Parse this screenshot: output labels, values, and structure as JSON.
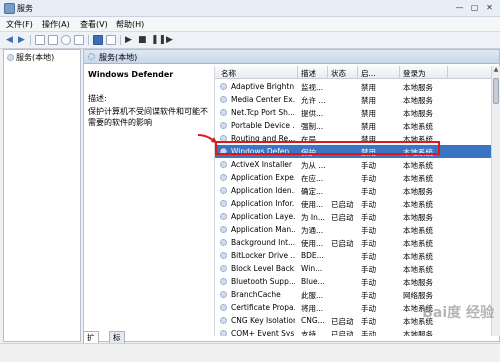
{
  "window": {
    "title": "服务",
    "minimize": "—",
    "maximize": "▢",
    "close": "✕"
  },
  "menu": [
    "文件(F)",
    "操作(A)",
    "查看(V)",
    "帮助(H)"
  ],
  "toolbar": {
    "icons": [
      "back-icon",
      "forward-icon",
      "console-tree-icon",
      "properties-icon",
      "refresh-icon",
      "export-icon",
      "help-icon",
      "view-icon",
      "start-icon",
      "stop-icon",
      "pause-icon",
      "restart-icon"
    ]
  },
  "tree": {
    "root": "服务(本地)"
  },
  "panel": {
    "header": "服务(本地)",
    "service_name": "Windows Defender",
    "desc_label": "描述:",
    "desc_text": "保护计算机不受间谍软件和可能不需要的软件的影响"
  },
  "columns": [
    "名称",
    "描述",
    "状态",
    "启...",
    "登录为"
  ],
  "rows": [
    {
      "name": "Adaptive Brightn...",
      "desc": "监视...",
      "status": "",
      "startup": "禁用",
      "logon": "本地服务"
    },
    {
      "name": "Media Center Ex...",
      "desc": "允许 ...",
      "status": "",
      "startup": "禁用",
      "logon": "本地服务"
    },
    {
      "name": "Net.Tcp Port Sh...",
      "desc": "提供...",
      "status": "",
      "startup": "禁用",
      "logon": "本地服务"
    },
    {
      "name": "Portable Device ...",
      "desc": "强制...",
      "status": "",
      "startup": "禁用",
      "logon": "本地系统"
    },
    {
      "name": "Routing and Re...",
      "desc": "在局...",
      "status": "",
      "startup": "禁用",
      "logon": "本地系统"
    },
    {
      "name": "Windows Defen...",
      "desc": "保护...",
      "status": "",
      "startup": "禁用",
      "logon": "本地系统",
      "selected": true
    },
    {
      "name": "ActiveX Installer ...",
      "desc": "为从 ...",
      "status": "",
      "startup": "手动",
      "logon": "本地系统"
    },
    {
      "name": "Application Expe...",
      "desc": "在应...",
      "status": "",
      "startup": "手动",
      "logon": "本地系统"
    },
    {
      "name": "Application Iden...",
      "desc": "确定...",
      "status": "",
      "startup": "手动",
      "logon": "本地服务"
    },
    {
      "name": "Application Infor...",
      "desc": "使用...",
      "status": "已启动",
      "startup": "手动",
      "logon": "本地系统"
    },
    {
      "name": "Application Laye...",
      "desc": "为 In...",
      "status": "已启动",
      "startup": "手动",
      "logon": "本地服务"
    },
    {
      "name": "Application Man...",
      "desc": "为通...",
      "status": "",
      "startup": "手动",
      "logon": "本地系统"
    },
    {
      "name": "Background Int...",
      "desc": "使用...",
      "status": "已启动",
      "startup": "手动",
      "logon": "本地系统"
    },
    {
      "name": "BitLocker Drive ...",
      "desc": "BDE...",
      "status": "",
      "startup": "手动",
      "logon": "本地系统"
    },
    {
      "name": "Block Level Back...",
      "desc": "Win...",
      "status": "",
      "startup": "手动",
      "logon": "本地系统"
    },
    {
      "name": "Bluetooth Supp...",
      "desc": "Blue...",
      "status": "",
      "startup": "手动",
      "logon": "本地服务"
    },
    {
      "name": "BranchCache",
      "desc": "此服...",
      "status": "",
      "startup": "手动",
      "logon": "网络服务"
    },
    {
      "name": "Certificate Propa...",
      "desc": "将用...",
      "status": "",
      "startup": "手动",
      "logon": "本地系统"
    },
    {
      "name": "CNG Key Isolation",
      "desc": "CNG...",
      "status": "已启动",
      "startup": "手动",
      "logon": "本地系统"
    },
    {
      "name": "COM+ Event Sys...",
      "desc": "支持...",
      "status": "已启动",
      "startup": "手动",
      "logon": "本地服务"
    }
  ],
  "tabs": [
    "扩展",
    "标准"
  ],
  "watermark": "Bai度 经验",
  "accent": "#3a75c4",
  "highlight_color": "#e0161b"
}
